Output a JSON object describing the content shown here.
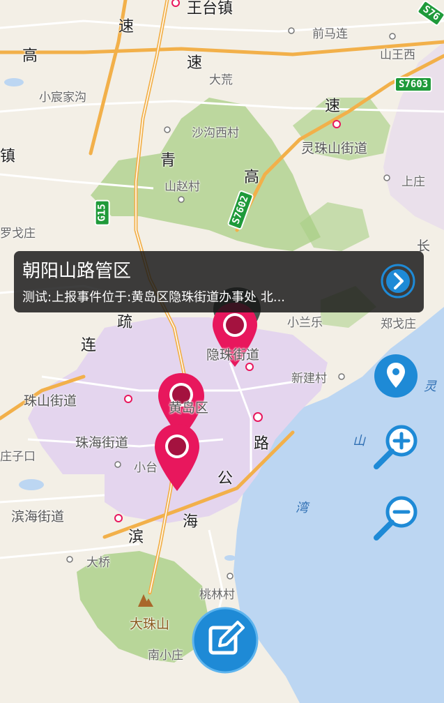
{
  "map": {
    "places": [
      {
        "name": "王台镇",
        "cls": "big"
      },
      {
        "name": "速",
        "cls": "big"
      },
      {
        "name": "前马连",
        "cls": "sm"
      },
      {
        "name": "高",
        "cls": "big"
      },
      {
        "name": "速",
        "cls": "big"
      },
      {
        "name": "大荒",
        "cls": "sm"
      },
      {
        "name": "山王西",
        "cls": "sm"
      },
      {
        "name": "小宸家沟",
        "cls": "sm"
      },
      {
        "name": "速",
        "cls": "big"
      },
      {
        "name": "沙沟西村",
        "cls": "sm"
      },
      {
        "name": "镇",
        "cls": "big"
      },
      {
        "name": "青",
        "cls": "big"
      },
      {
        "name": "灵珠山街道",
        "cls": "mid"
      },
      {
        "name": "高",
        "cls": "big"
      },
      {
        "name": "山赵村",
        "cls": "sm"
      },
      {
        "name": "上庄",
        "cls": "sm"
      },
      {
        "name": "罗戈庄",
        "cls": "sm"
      },
      {
        "name": "长",
        "cls": "mid"
      },
      {
        "name": "小兰乐",
        "cls": "sm"
      },
      {
        "name": "郑戈庄",
        "cls": "sm"
      },
      {
        "name": "疏",
        "cls": "big"
      },
      {
        "name": "连",
        "cls": "big"
      },
      {
        "name": "隐珠街道",
        "cls": "mid"
      },
      {
        "name": "新建村",
        "cls": "sm"
      },
      {
        "name": "珠山街道",
        "cls": "mid"
      },
      {
        "name": "黄岛区",
        "cls": "mid"
      },
      {
        "name": "珠海街道",
        "cls": "mid"
      },
      {
        "name": "路",
        "cls": "big"
      },
      {
        "name": "庄子口",
        "cls": "sm"
      },
      {
        "name": "小台",
        "cls": "sm"
      },
      {
        "name": "公",
        "cls": "big"
      },
      {
        "name": "滨海街道",
        "cls": "mid"
      },
      {
        "name": "海",
        "cls": "big"
      },
      {
        "name": "滨",
        "cls": "big"
      },
      {
        "name": "大桥",
        "cls": "sm"
      },
      {
        "name": "桃林村",
        "cls": "sm"
      },
      {
        "name": "大珠山",
        "cls": "mid"
      },
      {
        "name": "南小庄",
        "cls": "sm"
      }
    ],
    "water_labels": [
      "灵",
      "山",
      "湾"
    ],
    "shields": [
      "S76",
      "S7603",
      "G15",
      "S7602"
    ]
  },
  "popup": {
    "title": "朝阳山路管区",
    "subtitle": "测试:上报事件位于:黄岛区隐珠街道办事处 北..."
  },
  "colors": {
    "land": "#f3efe6",
    "sea": "#bcd6f2",
    "urban": "#e4d5ee",
    "forest": "#a9cf86",
    "highway": "#f2b04a",
    "road": "#ffffff",
    "marker": "#e8175d",
    "marker_dot": "#a4123f",
    "accent": "#1e8ad6"
  },
  "controls": [
    "location-icon",
    "zoom-in-icon",
    "zoom-out-icon",
    "edit-icon"
  ]
}
